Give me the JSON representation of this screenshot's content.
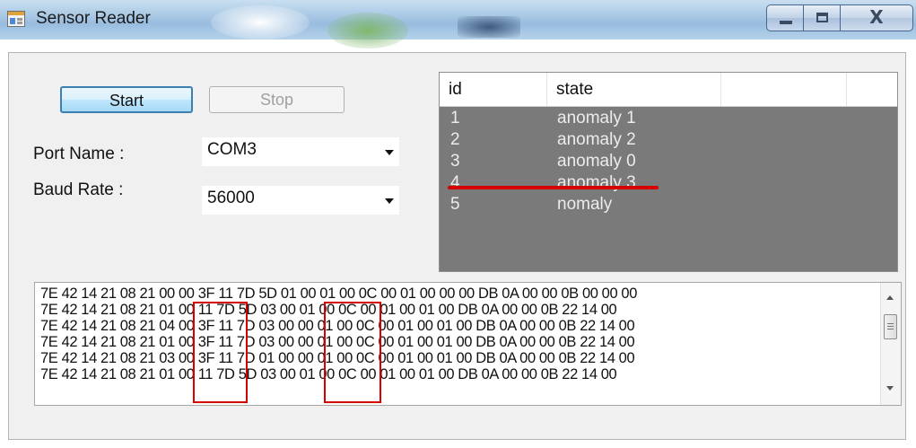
{
  "window": {
    "title": "Sensor Reader",
    "close_glyph": "X"
  },
  "controls": {
    "start_label": "Start",
    "stop_label": "Stop",
    "port_label": "Port Name :",
    "port_value": "COM3",
    "baud_label": "Baud Rate :",
    "baud_value": "56000"
  },
  "table": {
    "columns": [
      "id",
      "state",
      ""
    ],
    "rows": [
      {
        "id": "1",
        "state": "anomaly 1"
      },
      {
        "id": "2",
        "state": "anomaly 2"
      },
      {
        "id": "3",
        "state": "anomaly 0"
      },
      {
        "id": "4",
        "state": "anomaly 3"
      },
      {
        "id": "5",
        "state": "nomaly"
      }
    ]
  },
  "log_lines": [
    "7E 42 14 21 08 21 00 00 3F 11 7D 5D 01 00 01 00 0C 00 01 00 00 00 DB 0A 00 00 0B 00 00 00",
    "7E 42 14 21 08 21 01 00 11 7D 5D 03 00 01 00 0C 00 01 00 01 00 DB 0A 00 00 0B 22 14 00",
    "7E 42 14 21 08 21 04 00 3F 11 7D 03 00 00 01 00 0C 00 01 00 01 00 DB 0A 00 00 0B 22 14 00",
    "7E 42 14 21 08 21 01 00 3F 11 7D 03 00 00 01 00 0C 00 01 00 01 00 DB 0A 00 00 0B 22 14 00",
    "7E 42 14 21 08 21 03 00 3F 11 7D 01 00 00 01 00 0C 00 01 00 01 00 DB 0A 00 00 0B 22 14 00",
    "7E 42 14 21 08 21 01 00 11 7D 5D 03 00 01 00 0C 00 01 00 01 00 DB 0A 00 00 0B 22 14 00"
  ],
  "colors": {
    "highlight": "#d60000",
    "list_background": "#7a7a7a"
  },
  "icons": [
    "app-window-icon",
    "minimize-icon",
    "maximize-icon",
    "close-icon",
    "scroll-up-arrow-icon",
    "scroll-down-arrow-icon",
    "dropdown-arrow-icon"
  ]
}
